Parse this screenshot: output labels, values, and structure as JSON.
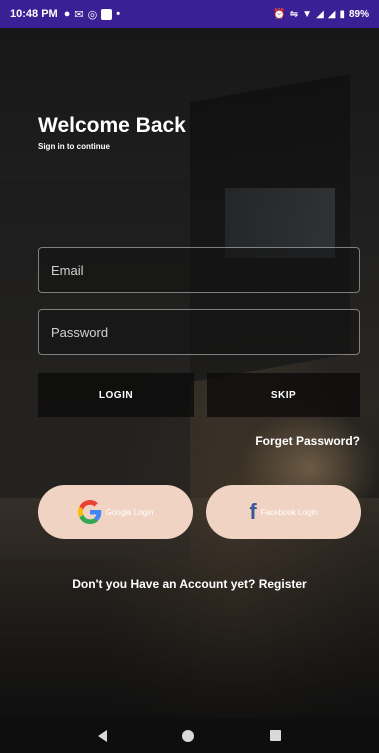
{
  "status_bar": {
    "time": "10:48 PM",
    "left_icons": [
      "messenger-icon",
      "gallery-icon",
      "instagram-icon",
      "square-icon",
      "dot-icon"
    ],
    "right_icons": [
      "alarm-icon",
      "vibrate-icon",
      "wifi-icon",
      "signal-icon",
      "signal-icon",
      "battery-icon"
    ],
    "battery": "89%"
  },
  "header": {
    "title": "Welcome Back",
    "subtitle": "Sign in to continue"
  },
  "form": {
    "email_placeholder": "Email",
    "password_placeholder": "Password",
    "login_label": "LOGIN",
    "skip_label": "SKIP",
    "forget_label": "Forget Password?"
  },
  "social": {
    "google_label": "Google Login",
    "facebook_label": "Facebook Login",
    "button_color": "#f0d3c3"
  },
  "footer": {
    "register_text": "Don't you Have an Account yet? Register"
  },
  "nav": {
    "icons": [
      "back-icon",
      "home-icon",
      "recent-apps-icon"
    ]
  },
  "colors": {
    "status_bar": "#3b1f95",
    "facebook_blue": "#3b5998"
  }
}
